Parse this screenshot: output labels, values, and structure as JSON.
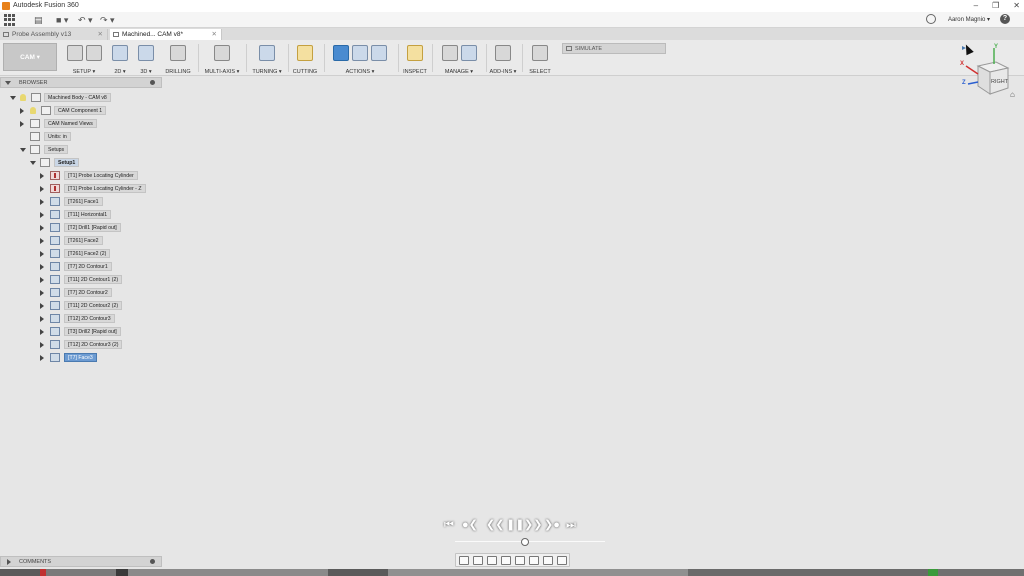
{
  "window": {
    "title": "Autodesk Fusion 360",
    "minimize": "–",
    "maximize": "❐",
    "close": "✕"
  },
  "quick_access": {
    "user": "Aaron Magnio ▾",
    "help": "?",
    "undo": "↶ ▾",
    "redo": "↷ ▾",
    "save": "■ ▾"
  },
  "tabs": [
    {
      "label": "Probe Assembly v13",
      "close": "✕"
    },
    {
      "label": "Machined... CAM v8*",
      "close": "✕"
    }
  ],
  "ribbon": {
    "workspace": "CAM ▾",
    "groups": [
      {
        "label": "SETUP ▾"
      },
      {
        "label": "2D ▾"
      },
      {
        "label": "3D ▾"
      },
      {
        "label": "DRILLING"
      },
      {
        "label": "MULTI-AXIS ▾"
      },
      {
        "label": "TURNING ▾"
      },
      {
        "label": "CUTTING"
      },
      {
        "label": "ACTIONS ▾"
      },
      {
        "label": "INSPECT"
      },
      {
        "label": "MANAGE ▾"
      },
      {
        "label": "ADD-INS ▾"
      },
      {
        "label": "SELECT"
      }
    ],
    "simulate": "SIMULATE"
  },
  "browser": {
    "title": "BROWSER",
    "items": [
      {
        "label": "Machined Body - CAM v8"
      },
      {
        "label": "CAM Component 1"
      },
      {
        "label": "CAM Named Views"
      },
      {
        "label": "Units: in"
      },
      {
        "label": "Setups"
      },
      {
        "label": "Setup1"
      },
      {
        "label": "[T1] Probe Locating Cylinder"
      },
      {
        "label": "[T1] Probe Locating Cylinder - Z"
      },
      {
        "label": "[T261] Face1"
      },
      {
        "label": "[T11] Horizontal1"
      },
      {
        "label": "[T2] Drill1 [Rapid out]"
      },
      {
        "label": "[T261] Face2"
      },
      {
        "label": "[T261] Face2 (2)"
      },
      {
        "label": "[T7] 2D Contour1"
      },
      {
        "label": "[T11] 2D Contour1 (2)"
      },
      {
        "label": "[T7] 2D Contour2"
      },
      {
        "label": "[T11] 2D Contour2 (2)"
      },
      {
        "label": "[T12] 2D Contour3"
      },
      {
        "label": "[T3] Drill2 [Rapid out]"
      },
      {
        "label": "[T12] 2D Contour3 (2)"
      },
      {
        "label": "[T7] Face3"
      }
    ]
  },
  "viewcube": {
    "face": "RIGHT",
    "axes": {
      "x": "X",
      "y": "Y",
      "z": "Z"
    }
  },
  "comments": {
    "title": "COMMENTS"
  },
  "colors": {
    "accent": "#4a8bd0",
    "selected_row": "#6c9bd2",
    "part": "#e8e4da",
    "table": "#f0a770",
    "base_plate": "#cfd0d1",
    "tool_holder": "#1d2936"
  }
}
